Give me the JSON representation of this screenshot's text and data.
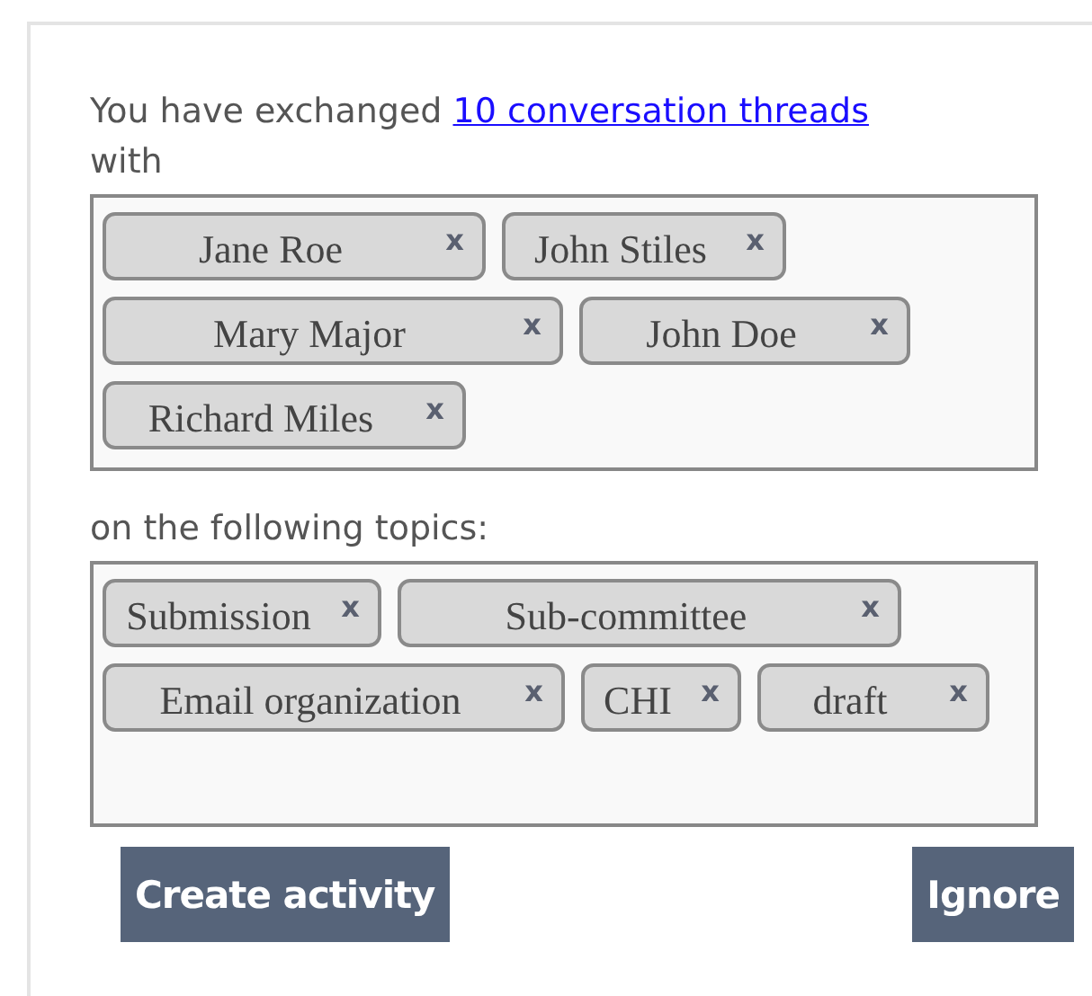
{
  "intro": {
    "before": "You have exchanged",
    "link": "10 conversation threads",
    "after": "with"
  },
  "people": [
    {
      "label": "Jane Roe",
      "remove": "x"
    },
    {
      "label": "John Stiles",
      "remove": "x"
    },
    {
      "label": "Mary Major",
      "remove": "x"
    },
    {
      "label": "John Doe",
      "remove": "x"
    },
    {
      "label": "Richard Miles",
      "remove": "x"
    }
  ],
  "topics_label": "on the following topics:",
  "topics": [
    {
      "label": "Submission",
      "remove": "x"
    },
    {
      "label": "Sub-committee",
      "remove": "x"
    },
    {
      "label": "Email organization",
      "remove": "x"
    },
    {
      "label": "CHI",
      "remove": "x"
    },
    {
      "label": "draft",
      "remove": "x"
    }
  ],
  "buttons": [
    "Create activity",
    "Ignore"
  ]
}
